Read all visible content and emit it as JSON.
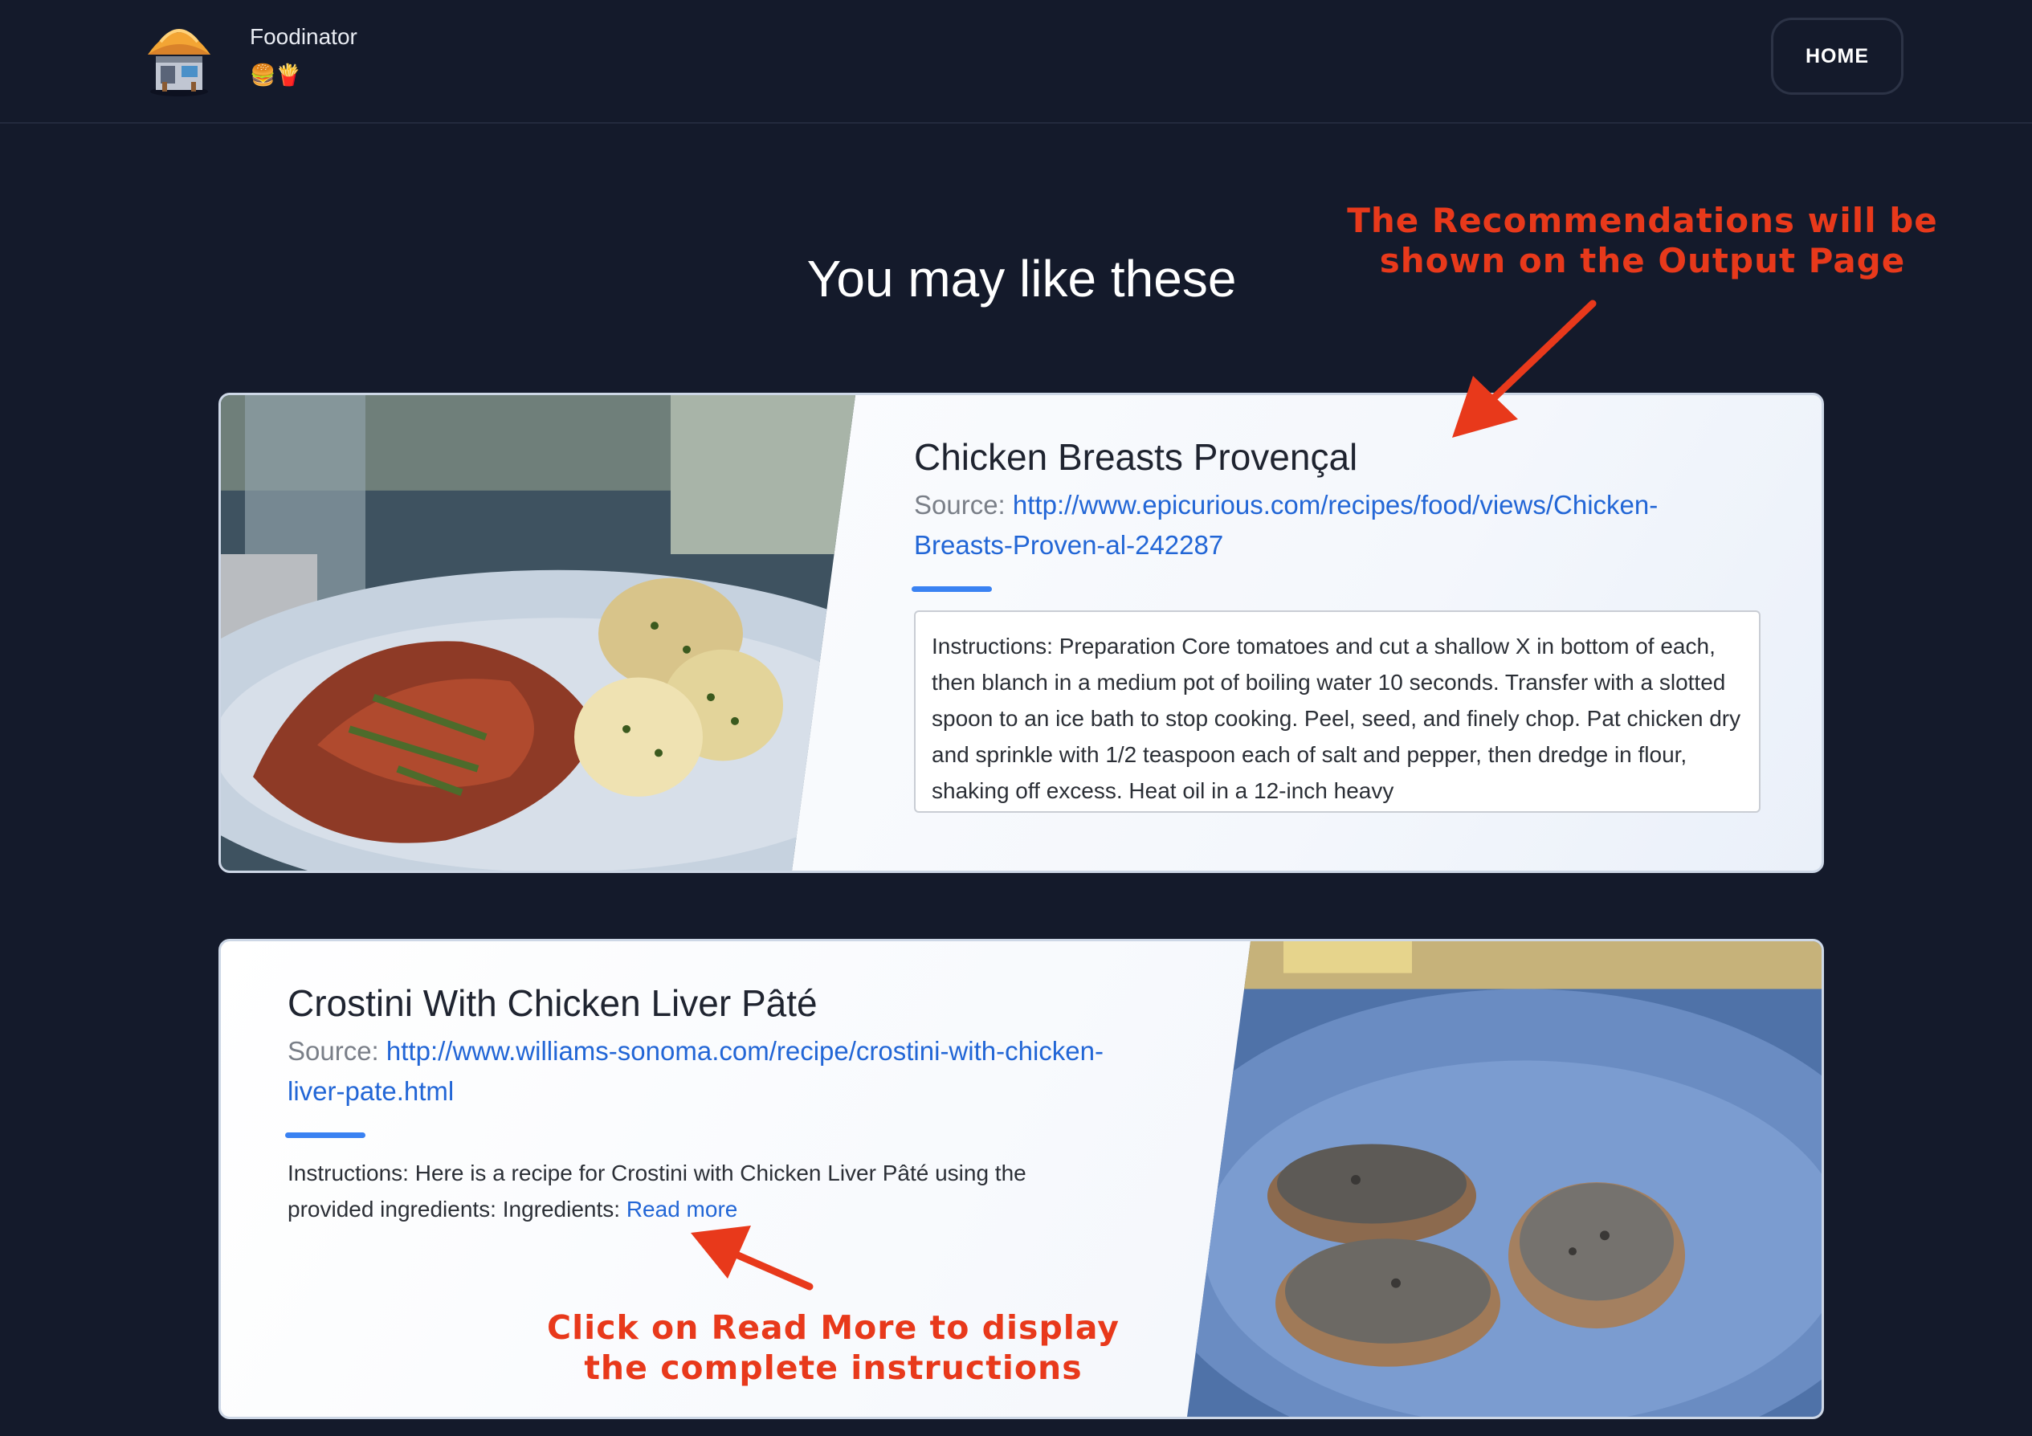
{
  "header": {
    "brand_name": "Foodinator",
    "brand_emoji": "🍔🍟",
    "home_label": "HOME"
  },
  "main": {
    "title": "You may like these"
  },
  "annotations": {
    "top": "The Recommendations will be shown on the Output Page",
    "bottom": "Click on Read More to display the complete instructions",
    "color": "#e8391b"
  },
  "recipes": [
    {
      "title": "Chicken Breasts Provençal",
      "source_label": "Source:",
      "source_url": "http://www.epicurious.com/recipes/food/views/Chicken-Breasts-Proven-al-242287",
      "instructions": "Instructions: Preparation Core tomatoes and cut a shallow X in bottom of each, then blanch in a medium pot of boiling water 10 seconds. Transfer with a slotted spoon to an ice bath to stop cooking. Peel, seed, and finely chop. Pat chicken dry and sprinkle with 1/2 teaspoon each of salt and pepper, then dredge in flour, shaking off excess. Heat oil in a 12-inch heavy",
      "image_icon": "plated-chicken-photo"
    },
    {
      "title": "Crostini With Chicken Liver Pâté",
      "source_label": "Source:",
      "source_url": "http://www.williams-sonoma.com/recipe/crostini-with-chicken-liver-pate.html",
      "instructions": "Instructions: Here is a recipe for Crostini with Chicken Liver Pâté using the provided ingredients: Ingredients:",
      "read_more_label": "Read more",
      "image_icon": "crostini-photo"
    }
  ],
  "colors": {
    "background": "#141a2b",
    "link": "#2266d6",
    "accent_bar": "#3a82f2"
  }
}
